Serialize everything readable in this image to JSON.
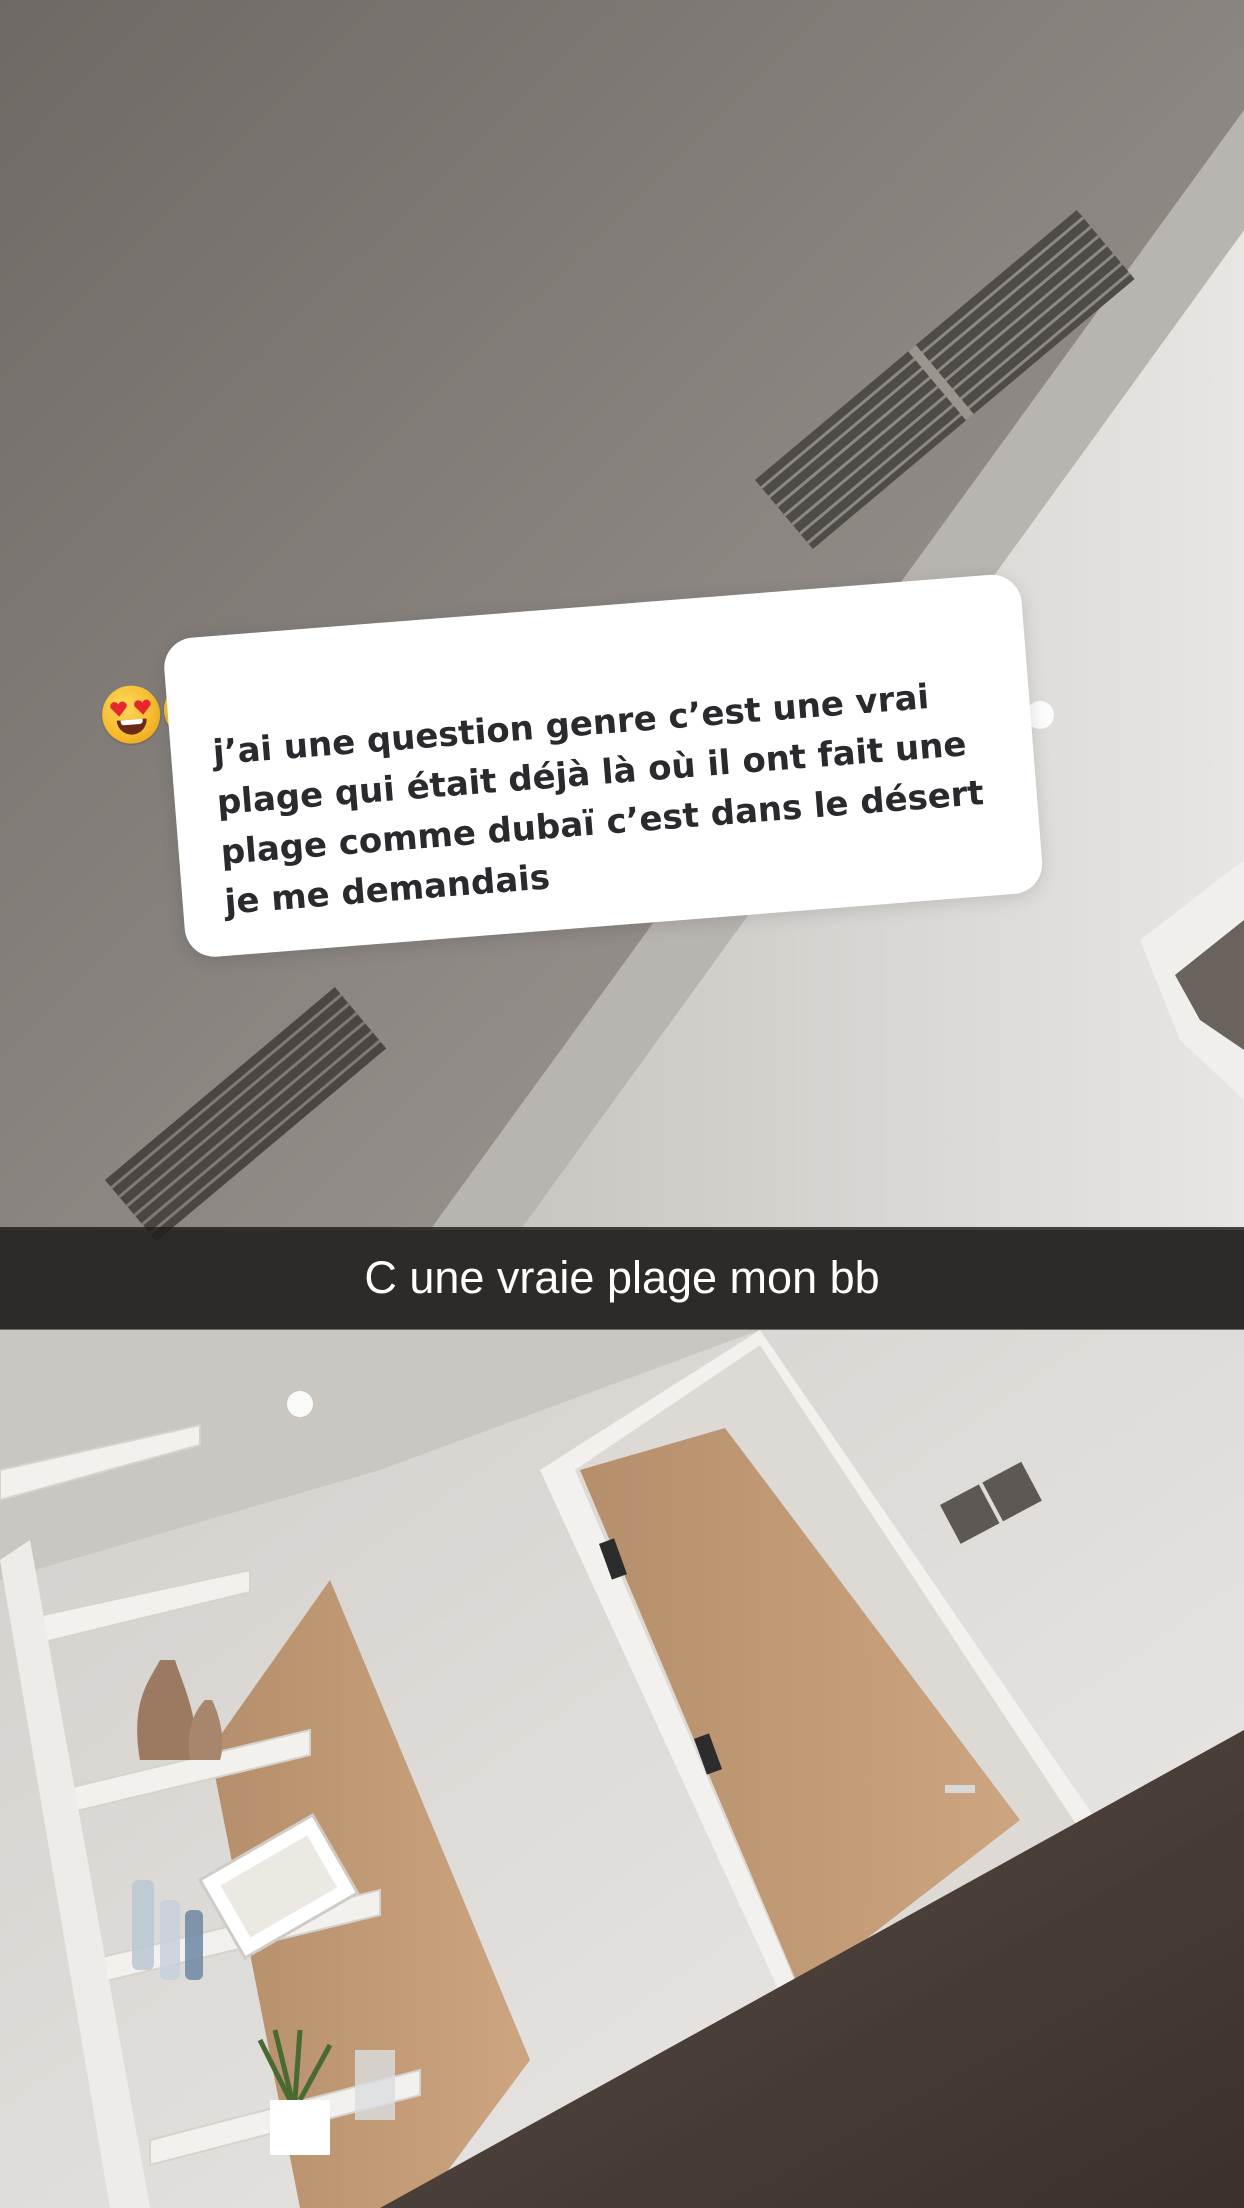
{
  "sticker": {
    "emojis": [
      "heart-eyes-emoji",
      "heart-eyes-emoji",
      "heart-eyes-emoji",
      "heart-eyes-emoji",
      "heart-eyes-emoji"
    ],
    "question": "j’ai une question genre c’est une vrai plage qui était déjà là où il ont fait une plage comme dubaï c’est dans le désert je me demandais"
  },
  "caption": {
    "text": "C une vraie plage mon bb"
  },
  "colors": {
    "caption_bar": "#1e1c1a",
    "sticker_bg": "#ffffff",
    "sticker_text": "#2a2a2e"
  }
}
